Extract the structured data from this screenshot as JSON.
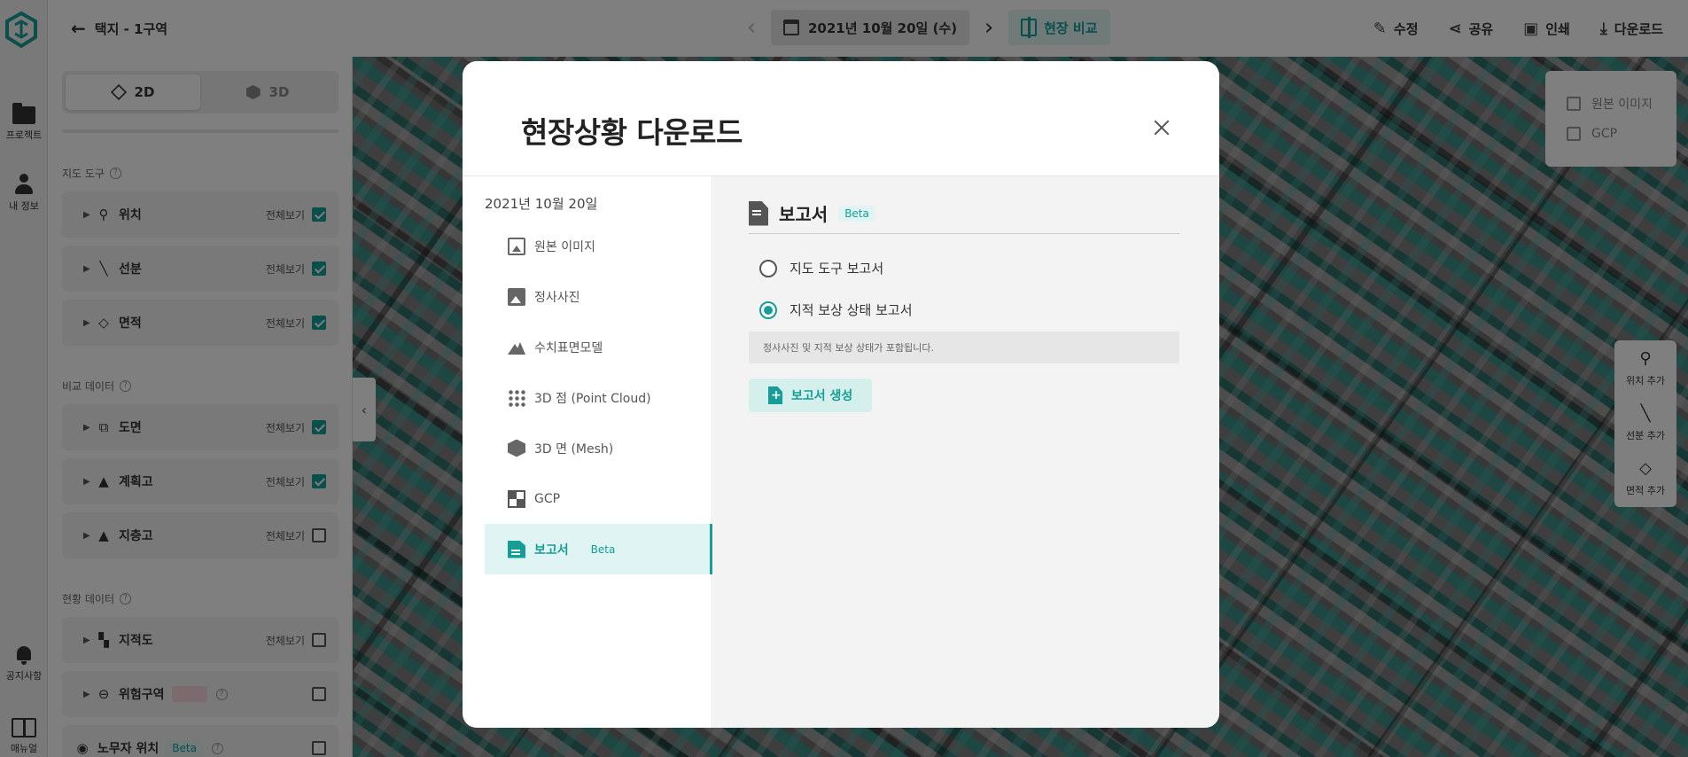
{
  "topbar": {
    "project_title": "택지 - 1구역",
    "date": "2021년 10월 20일 (수)",
    "compare_label": "현장 비교",
    "actions": {
      "edit": "수정",
      "share": "공유",
      "print": "인쇄",
      "download": "다운로드"
    }
  },
  "rail": {
    "project": "프로젝트",
    "my_info": "내 정보",
    "notice": "공지사항",
    "manual": "매뉴얼"
  },
  "panel": {
    "view_2d": "2D",
    "view_3d": "3D",
    "map_tools_title": "지도 도구",
    "compare_data_title": "비교 데이터",
    "site_data_title": "현황 데이터",
    "show_all": "전체보기",
    "map_tools": [
      {
        "label": "위치",
        "checked": true
      },
      {
        "label": "선분",
        "checked": true
      },
      {
        "label": "면적",
        "checked": true
      }
    ],
    "compare_data": [
      {
        "label": "도면",
        "checked": true
      },
      {
        "label": "계획고",
        "checked": true
      },
      {
        "label": "지층고",
        "checked": false
      }
    ],
    "site_data": [
      {
        "label": "지적도",
        "checked": false
      },
      {
        "label": "위험구역",
        "checked": false
      },
      {
        "label": "노무자 위치",
        "checked": false,
        "beta": "Beta"
      }
    ]
  },
  "map_layers": {
    "original_image": "원본 이미지",
    "gcp": "GCP"
  },
  "map_tools": {
    "add_location": "위치 추가",
    "add_line": "선분 추가",
    "add_area": "면적 추가"
  },
  "modal": {
    "title": "현장상황 다운로드",
    "date": "2021년 10월 20일",
    "menu": [
      {
        "label": "원본 이미지",
        "icon": "images-icon"
      },
      {
        "label": "정사사진",
        "icon": "photo-icon"
      },
      {
        "label": "수치표면모델",
        "icon": "mountain-icon"
      },
      {
        "label": "3D 점 (Point Cloud)",
        "icon": "point-cloud-icon"
      },
      {
        "label": "3D 면 (Mesh)",
        "icon": "mesh-icon"
      },
      {
        "label": "GCP",
        "icon": "gcp-icon"
      },
      {
        "label": "보고서",
        "icon": "report-icon",
        "beta": "Beta",
        "active": true
      }
    ],
    "report": {
      "title": "보고서",
      "beta": "Beta",
      "options": [
        {
          "label": "지도 도구 보고서",
          "selected": false
        },
        {
          "label": "지적 보상 상태 보고서",
          "selected": true
        }
      ],
      "info": "정사사진 및 지적 보상 상태가 포함됩니다.",
      "generate_button": "보고서 생성"
    }
  },
  "colors": {
    "accent": "#159e97",
    "accent_light": "#e0f5f3"
  }
}
